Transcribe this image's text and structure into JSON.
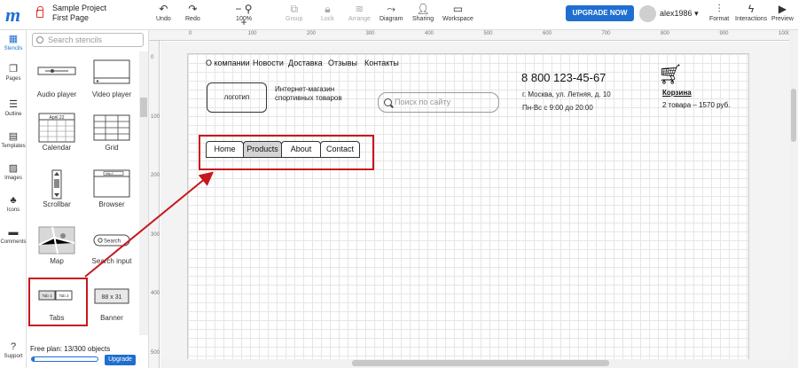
{
  "header": {
    "project_title": "Sample Project",
    "page_name": "First Page",
    "tools": [
      {
        "label": "Undo",
        "icon": "undo-icon",
        "enabled": true
      },
      {
        "label": "Redo",
        "icon": "redo-icon",
        "enabled": true
      },
      {
        "label": "100%",
        "icon": "zoom-icon",
        "enabled": true
      },
      {
        "label": "Group",
        "icon": "group-icon",
        "enabled": false
      },
      {
        "label": "Lock",
        "icon": "lock-icon",
        "enabled": false
      },
      {
        "label": "Arrange",
        "icon": "arrange-icon",
        "enabled": false
      },
      {
        "label": "Diagram",
        "icon": "diagram-icon",
        "enabled": true
      },
      {
        "label": "Sharing",
        "icon": "sharing-icon",
        "enabled": true
      },
      {
        "label": "Workspace",
        "icon": "workspace-icon",
        "enabled": true
      }
    ],
    "zoom_minus": "−",
    "zoom_plus": "+",
    "upgrade_label": "UPGRADE NOW",
    "username": "alex1986",
    "right_tools": [
      {
        "label": "Format",
        "icon": "format-icon"
      },
      {
        "label": "Interactions",
        "icon": "interactions-icon"
      },
      {
        "label": "Preview",
        "icon": "preview-icon"
      }
    ]
  },
  "leftbar": {
    "items": [
      {
        "label": "Stencils",
        "icon": "stencils-icon",
        "active": true
      },
      {
        "label": "Pages",
        "icon": "pages-icon"
      },
      {
        "label": "Outline",
        "icon": "outline-icon"
      },
      {
        "label": "Templates",
        "icon": "templates-icon"
      },
      {
        "label": "Images",
        "icon": "images-icon"
      },
      {
        "label": "Icons",
        "icon": "icons-icon"
      },
      {
        "label": "Comments",
        "icon": "comments-icon"
      }
    ],
    "support_label": "Support"
  },
  "stencils": {
    "search_placeholder": "Search stencils",
    "items": [
      {
        "label": "Audio player"
      },
      {
        "label": "Video player"
      },
      {
        "label": "Calendar",
        "thumb_text": "April 22"
      },
      {
        "label": "Grid"
      },
      {
        "label": "Scrollbar"
      },
      {
        "label": "Browser",
        "thumb_text": "http://"
      },
      {
        "label": "Map"
      },
      {
        "label": "Search input",
        "thumb_text": "Search"
      },
      {
        "label": "Tabs",
        "thumb_tabs": [
          "Tab 1",
          "Tab 2"
        ]
      },
      {
        "label": "Banner",
        "thumb_text": "88 x 31"
      }
    ],
    "plan_text": "Free plan: 13/300 objects",
    "plan_progress": 0.0433,
    "upgrade_label": "Upgrade"
  },
  "rulers": {
    "top_ticks": [
      "0",
      "100",
      "200",
      "300",
      "400",
      "500",
      "600",
      "700",
      "800",
      "900",
      "1000"
    ],
    "left_ticks": [
      "0",
      "100",
      "200",
      "300",
      "400",
      "500"
    ]
  },
  "wireframe": {
    "nav_links": [
      "О компании",
      "Новости",
      "Доставка",
      "Отзывы",
      "Контакты"
    ],
    "logo_text": "логотип",
    "shop_line1": "Интернет-магазин",
    "shop_line2": "спортивных товаров",
    "site_search_placeholder": "Поиск по сайту",
    "phone": "8 800 123-45-67",
    "address": "г. Москва, ул. Летняя, д. 10",
    "hours": "Пн-Вс с 9:00 до 20:00",
    "cart_label": "Корзина",
    "cart_info": "2 товара – 1570 руб.",
    "tabs": [
      {
        "label": "Home",
        "active": false
      },
      {
        "label": "Products",
        "active": true
      },
      {
        "label": "About",
        "active": false
      },
      {
        "label": "Contact",
        "active": false
      }
    ]
  },
  "colors": {
    "accent": "#1f6fd1",
    "highlight": "#c8161d"
  }
}
